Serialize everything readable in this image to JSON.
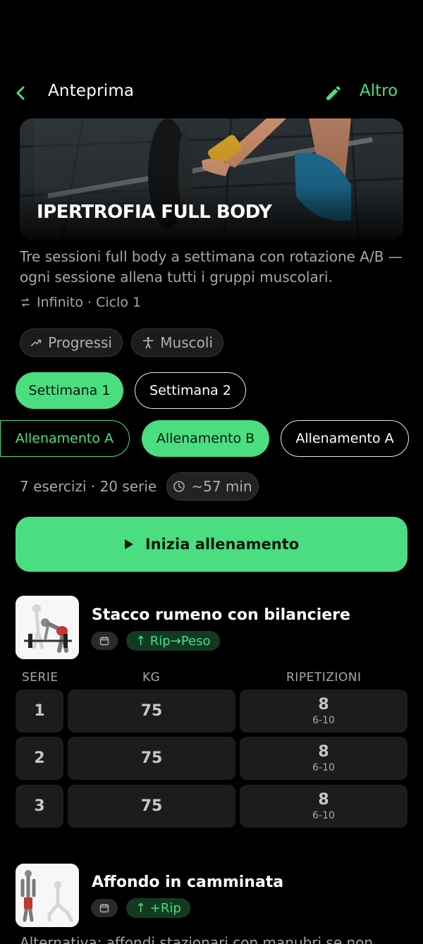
{
  "header": {
    "title": "Anteprima",
    "action_label": "Altro",
    "back_icon": "chevron-left-icon",
    "edit_icon": "pencil-icon",
    "accent": "#4ade80"
  },
  "program": {
    "title": "IPERTROFIA FULL BODY",
    "description": "Tre sessioni full body a settimana con rotazione A/B — ogni sessione allena tutti i gruppi muscolari.",
    "cycle": "Infinito · Ciclo 1"
  },
  "chips": {
    "progress": "Progressi",
    "muscles": "Muscoli"
  },
  "weeks": [
    {
      "label": "Settimana 1",
      "active": true
    },
    {
      "label": "Settimana 2",
      "active": false
    }
  ],
  "workouts": [
    {
      "label": "Allenamento A",
      "active": false
    },
    {
      "label": "Allenamento B",
      "active": true
    },
    {
      "label": "Allenamento A",
      "active": false
    }
  ],
  "summary": {
    "stats": "7 esercizi · 20 serie",
    "duration": "~57 min"
  },
  "start_button": "Inizia allenamento",
  "table_headers": {
    "set": "SERIE",
    "kg": "KG",
    "reps": "RIPETIZIONI"
  },
  "exercises": [
    {
      "name": "Stacco rumeno con bilanciere",
      "progression": "↑ Rip→Peso",
      "sets": [
        {
          "set": "1",
          "kg": "75",
          "reps": "8",
          "range": "6-10"
        },
        {
          "set": "2",
          "kg": "75",
          "reps": "8",
          "range": "6-10"
        },
        {
          "set": "3",
          "kg": "75",
          "reps": "8",
          "range": "6-10"
        }
      ]
    },
    {
      "name": "Affondo in camminata",
      "progression": "↑ +Rip",
      "note": "Alternativa: affondi stazionari con manubri se non"
    }
  ]
}
